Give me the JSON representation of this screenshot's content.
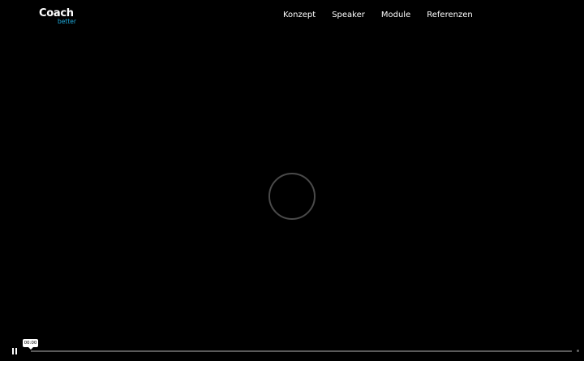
{
  "header": {
    "logo": {
      "main": "Coach",
      "sub": "better"
    },
    "nav": [
      {
        "label": "Konzept"
      },
      {
        "label": "Speaker"
      },
      {
        "label": "Module"
      },
      {
        "label": "Referenzen"
      }
    ]
  },
  "player": {
    "state": "playing",
    "current_time": "00:00",
    "progress_fraction": 0.0,
    "loading_indicator": "ring-spinner-icon",
    "toggle_icon": "pause-icon"
  },
  "colors": {
    "background": "#000000",
    "text": "#ffffff",
    "brand_accent": "#1fa8d8",
    "track": "#5a5a5a"
  }
}
